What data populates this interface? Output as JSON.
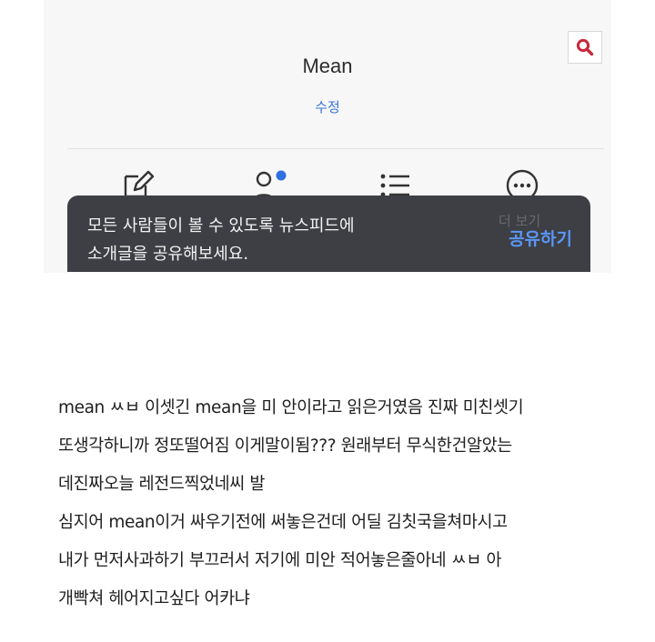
{
  "profile": {
    "name": "Mean",
    "edit_label": "수정"
  },
  "toolbar": {
    "search_icon": "search-icon",
    "actions": [
      {
        "icon": "edit-icon"
      },
      {
        "icon": "person-icon"
      },
      {
        "icon": "list-icon"
      },
      {
        "icon": "more-icon",
        "label": "더 보기"
      }
    ]
  },
  "tooltip": {
    "lines": [
      "모든 사람들이 볼 수 있도록 뉴스피드에",
      "소개글을 공유해보세요."
    ],
    "action_label": "공유하기"
  },
  "post": {
    "lines": [
      "mean ㅆㅂ 이셋긴 mean을 미 안이라고 읽은거였음 진짜 미친셋기",
      "또생각하니까 정또떨어짐 이게말이됨??? 원래부터 무식한건알았는",
      "데진짜오늘 레전드찍었네씨 발",
      "심지어 mean이거 싸우기전에 써놓은건데 어딜 김칫국을쳐마시고",
      "내가 먼저사과하기 부끄러서 저기에 미안 적어놓은줄아네 ㅆㅂ 아",
      "개빡쳐 헤어지고싶다 어카냐"
    ]
  },
  "colors": {
    "accent_blue": "#3b73d8",
    "tooltip_bg": "#3d3f44",
    "search_red": "#c8283a",
    "badge_blue": "#2f6fe0"
  }
}
